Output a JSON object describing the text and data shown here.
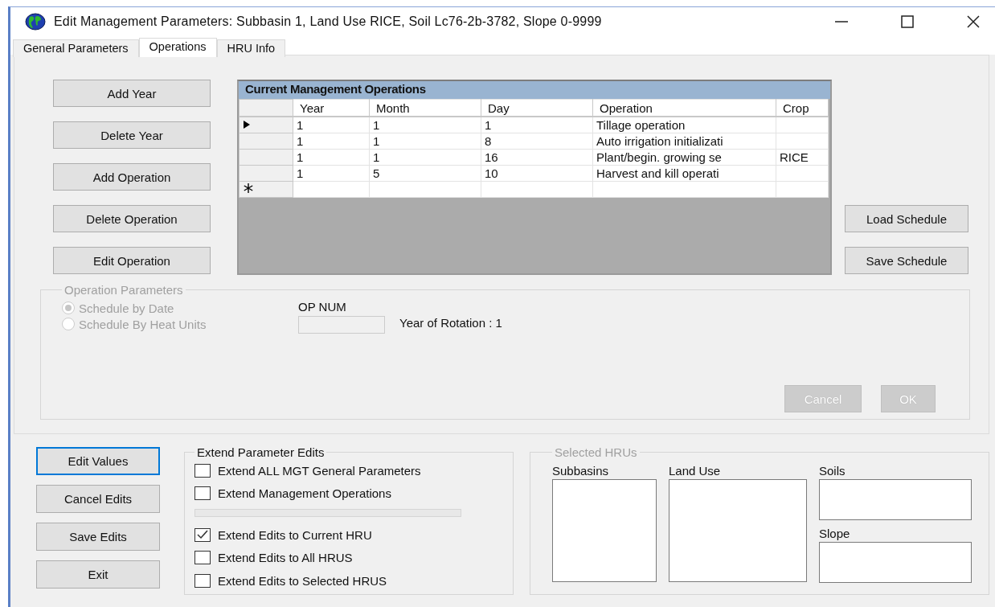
{
  "window": {
    "title": "Edit Management Parameters: Subbasin 1, Land Use RICE, Soil Lc76-2b-3782, Slope 0-9999"
  },
  "tabs": [
    {
      "label": "General Parameters",
      "selected": false
    },
    {
      "label": "Operations",
      "selected": true
    },
    {
      "label": "HRU Info",
      "selected": false
    }
  ],
  "left_buttons": [
    "Add Year",
    "Delete Year",
    "Add Operation",
    "Delete Operation",
    "Edit Operation"
  ],
  "grid": {
    "title": "Current Management Operations",
    "columns": [
      "Year",
      "Month",
      "Day",
      "Operation",
      "Crop"
    ],
    "rows": [
      {
        "current": true,
        "cells": [
          "1",
          "1",
          "1",
          "Tillage operation",
          ""
        ]
      },
      {
        "current": false,
        "cells": [
          "1",
          "1",
          "8",
          "Auto irrigation initializati",
          ""
        ]
      },
      {
        "current": false,
        "cells": [
          "1",
          "1",
          "16",
          "Plant/begin. growing se",
          "RICE"
        ]
      },
      {
        "current": false,
        "cells": [
          "1",
          "5",
          "10",
          "Harvest and kill operati",
          ""
        ]
      }
    ],
    "new_row": true
  },
  "right_buttons": [
    "Load Schedule",
    "Save Schedule"
  ],
  "operation_parameters": {
    "title": "Operation Parameters",
    "radios": [
      {
        "label": "Schedule by Date",
        "selected": true
      },
      {
        "label": "Schedule By Heat Units",
        "selected": false
      }
    ],
    "op_num_label": "OP NUM",
    "year_of_rotation": "Year of Rotation : 1",
    "buttons": [
      {
        "label": "Cancel",
        "disabled": true
      },
      {
        "label": "OK",
        "disabled": true
      }
    ]
  },
  "bottom_buttons": [
    {
      "label": "Edit Values",
      "focused": true
    },
    {
      "label": "Cancel Edits",
      "focused": false
    },
    {
      "label": "Save Edits",
      "focused": false
    },
    {
      "label": "Exit",
      "focused": false
    }
  ],
  "extend": {
    "title": "Extend Parameter Edits",
    "checks_top": [
      {
        "label": "Extend ALL MGT General Parameters",
        "checked": false
      },
      {
        "label": "Extend Management Operations",
        "checked": false
      }
    ],
    "progress": {
      "level": 0
    },
    "checks_bottom": [
      {
        "label": "Extend Edits to Current HRU",
        "checked": true
      },
      {
        "label": "Extend Edits to All HRUS",
        "checked": false
      },
      {
        "label": "Extend Edits to Selected HRUS",
        "checked": false
      }
    ]
  },
  "selected_hrus": {
    "title": "Selected HRUs",
    "subbasins_label": "Subbasins",
    "land_use_label": "Land Use",
    "soils_label": "Soils",
    "slope_label": "Slope"
  }
}
